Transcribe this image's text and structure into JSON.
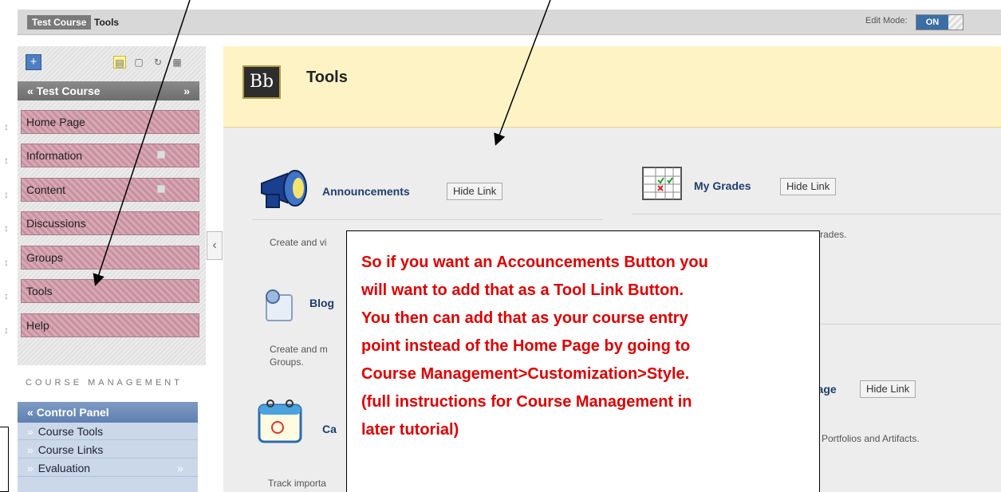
{
  "breadcrumb": {
    "course": "Test Course",
    "page": "Tools"
  },
  "edit_mode": {
    "label": "Edit Mode:",
    "state": "ON"
  },
  "sidebar": {
    "course_title": "Test Course",
    "items": [
      {
        "label": "Home Page"
      },
      {
        "label": "Information"
      },
      {
        "label": "Content"
      },
      {
        "label": "Discussions"
      },
      {
        "label": "Groups"
      },
      {
        "label": "Tools"
      },
      {
        "label": "Help"
      }
    ]
  },
  "course_management": {
    "title": "COURSE MANAGEMENT",
    "panel_title": "Control Panel",
    "items": [
      {
        "label": "Course Tools"
      },
      {
        "label": "Course Links"
      },
      {
        "label": "Evaluation"
      }
    ]
  },
  "main": {
    "logo_text": "Bb",
    "title": "Tools",
    "tools": [
      {
        "name": "Announcements",
        "hide_label": "Hide Link",
        "description": "Create and vi"
      },
      {
        "name": "My Grades",
        "hide_label": "Hide Link",
        "description": "Shows detailed information about your grades."
      },
      {
        "name": "Blog",
        "description": "Create and m",
        "description2": "Groups."
      },
      {
        "name": "page",
        "hide_label": "Hide Link",
        "description": "Portfolios and Artifacts."
      },
      {
        "name": "Ca",
        "description": "Track importa"
      }
    ]
  },
  "callout": {
    "lines": [
      "So if you want an Accouncements Button you",
      "will want to add that as a Tool Link Button.",
      "You then can add that as your course entry",
      "point instead of the Home Page by going to",
      "Course Management>Customization>Style.",
      "(full instructions for Course Management in",
      "later tutorial)"
    ]
  },
  "colors": {
    "callout_text": "#e00000",
    "nav_pink": "#d6a9b7",
    "header_yellow": "#fdf3c5",
    "link_blue": "#1f3e6e"
  },
  "icons": [
    "plus-icon",
    "list-view-icon",
    "folder-view-icon",
    "refresh-icon",
    "grid-view-icon",
    "megaphone-icon",
    "grade-table-icon",
    "blog-icon",
    "calendar-icon",
    "collapse-chevron-icon"
  ]
}
